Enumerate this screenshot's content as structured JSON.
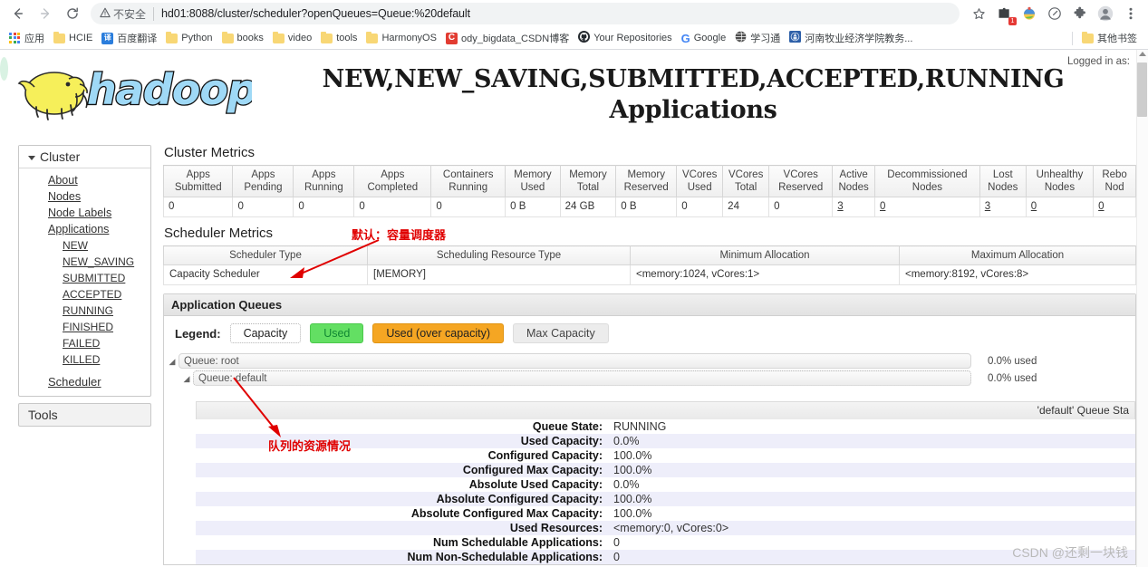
{
  "browser": {
    "back_icon": "back-arrow-icon",
    "forward_icon": "forward-arrow-icon",
    "reload_icon": "reload-icon",
    "warning_icon": "warning-triangle-icon",
    "not_secure_label": "不安全",
    "url": "hd01:8088/cluster/scheduler?openQueues=Queue:%20default",
    "star_icon": "bookmark-star-icon",
    "extension_badge_count": "1",
    "profile_icon": "profile-avatar-icon",
    "menu_icon": "three-dot-menu-icon",
    "bookmarks": [
      {
        "label": "应用",
        "icon": "apps-grid-icon",
        "type": "apps"
      },
      {
        "label": "HCIE",
        "icon": "folder-icon",
        "type": "folder"
      },
      {
        "label": "百度翻译",
        "icon": "translate-icon",
        "type": "square",
        "color": "#2a7ddc",
        "glyph": "译"
      },
      {
        "label": "Python",
        "icon": "folder-icon",
        "type": "folder"
      },
      {
        "label": "books",
        "icon": "folder-icon",
        "type": "folder"
      },
      {
        "label": "video",
        "icon": "folder-icon",
        "type": "folder"
      },
      {
        "label": "tools",
        "icon": "folder-icon",
        "type": "folder"
      },
      {
        "label": "HarmonyOS",
        "icon": "folder-icon",
        "type": "folder"
      },
      {
        "label": "ody_bigdata_CSDN博客",
        "icon": "csdn-icon",
        "type": "square",
        "color": "#e23c32",
        "glyph": "C"
      },
      {
        "label": "Your Repositories",
        "icon": "github-icon",
        "type": "github"
      },
      {
        "label": "Google",
        "icon": "google-icon",
        "type": "google"
      },
      {
        "label": "学习通",
        "icon": "globe-icon",
        "type": "globe"
      },
      {
        "label": "河南牧业经济学院教务...",
        "icon": "school-icon",
        "type": "school"
      }
    ],
    "other_bookmarks": {
      "label": "其他书签",
      "icon": "folder-icon"
    }
  },
  "header": {
    "logo_text": "hadoop",
    "logo_alt": "hadoop-elephant-logo",
    "title": "NEW,NEW_SAVING,SUBMITTED,ACCEPTED,RUNNING Applications",
    "logged_in_as": "Logged in as:"
  },
  "sidebar": {
    "cluster_label": "Cluster",
    "cluster_items": [
      {
        "label": "About"
      },
      {
        "label": "Nodes"
      },
      {
        "label": "Node Labels"
      },
      {
        "label": "Applications"
      }
    ],
    "application_states": [
      {
        "label": "NEW"
      },
      {
        "label": "NEW_SAVING"
      },
      {
        "label": "SUBMITTED"
      },
      {
        "label": "ACCEPTED"
      },
      {
        "label": "RUNNING"
      },
      {
        "label": "FINISHED"
      },
      {
        "label": "FAILED"
      },
      {
        "label": "KILLED"
      }
    ],
    "scheduler_label": "Scheduler",
    "tools_label": "Tools"
  },
  "cluster_metrics": {
    "title": "Cluster Metrics",
    "headers": [
      "Apps Submitted",
      "Apps Pending",
      "Apps Running",
      "Apps Completed",
      "Containers Running",
      "Memory Used",
      "Memory Total",
      "Memory Reserved",
      "VCores Used",
      "VCores Total",
      "VCores Reserved",
      "Active Nodes",
      "Decommissioned Nodes",
      "Lost Nodes",
      "Unhealthy Nodes",
      "Rebo Nod"
    ],
    "values": [
      "0",
      "0",
      "0",
      "0",
      "0",
      "0 B",
      "24 GB",
      "0 B",
      "0",
      "24",
      "0",
      "3",
      "0",
      "3",
      "0",
      "0"
    ]
  },
  "scheduler_metrics": {
    "title": "Scheduler Metrics",
    "headers": [
      "Scheduler Type",
      "Scheduling Resource Type",
      "Minimum Allocation",
      "Maximum Allocation"
    ],
    "values": [
      "Capacity Scheduler",
      "[MEMORY]",
      "<memory:1024, vCores:1>",
      "<memory:8192, vCores:8>"
    ]
  },
  "application_queues": {
    "panel_title": "Application Queues",
    "legend_label": "Legend:",
    "legend": [
      {
        "label": "Capacity",
        "style": "capacity"
      },
      {
        "label": "Used",
        "style": "used",
        "color": "#63df63"
      },
      {
        "label": "Used (over capacity)",
        "style": "over",
        "color": "#f5a623"
      },
      {
        "label": "Max Capacity",
        "style": "max",
        "color": "#ececec"
      }
    ],
    "queues": [
      {
        "label": "Queue: root",
        "used_text": "0.0% used",
        "level": 0
      },
      {
        "label": "Queue: default",
        "used_text": "0.0% used",
        "level": 1
      }
    ]
  },
  "queue_detail": {
    "title": "'default' Queue Sta",
    "rows": [
      {
        "key": "Queue State:",
        "value": "RUNNING"
      },
      {
        "key": "Used Capacity:",
        "value": "0.0%"
      },
      {
        "key": "Configured Capacity:",
        "value": "100.0%"
      },
      {
        "key": "Configured Max Capacity:",
        "value": "100.0%"
      },
      {
        "key": "Absolute Used Capacity:",
        "value": "0.0%"
      },
      {
        "key": "Absolute Configured Capacity:",
        "value": "100.0%"
      },
      {
        "key": "Absolute Configured Max Capacity:",
        "value": "100.0%"
      },
      {
        "key": "Used Resources:",
        "value": "<memory:0, vCores:0>"
      },
      {
        "key": "Num Schedulable Applications:",
        "value": "0"
      },
      {
        "key": "Num Non-Schedulable Applications:",
        "value": "0"
      }
    ]
  },
  "annotations": [
    {
      "text": "默认：容量调度器",
      "name": "annotation-default-capacity-scheduler"
    },
    {
      "text": "队列的资源情况",
      "name": "annotation-queue-resources"
    }
  ],
  "watermark": "CSDN @还剩一块钱"
}
